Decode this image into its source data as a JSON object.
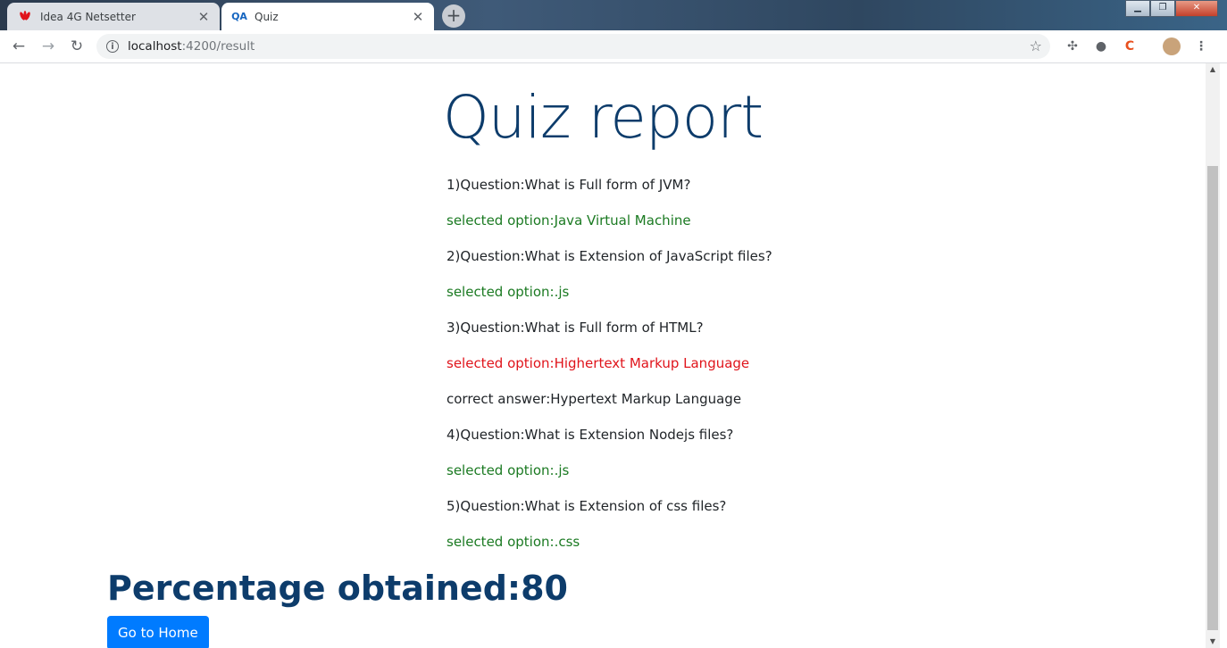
{
  "browser": {
    "tabs": [
      {
        "title": "Idea 4G Netsetter",
        "favicon": "huawei-icon",
        "active": false
      },
      {
        "title": "Quiz",
        "favicon": "QA",
        "active": true
      }
    ],
    "url_host": "localhost",
    "url_path": ":4200/result"
  },
  "page": {
    "title": "Quiz report",
    "items": [
      {
        "text": "1)Question:What is Full form of JVM?",
        "status": "question"
      },
      {
        "text": "selected option:Java Virtual Machine",
        "status": "correct"
      },
      {
        "text": "2)Question:What is Extension of JavaScript files?",
        "status": "question"
      },
      {
        "text": "selected option:.js",
        "status": "correct"
      },
      {
        "text": "3)Question:What is Full form of HTML?",
        "status": "question"
      },
      {
        "text": "selected option:Highertext Markup Language",
        "status": "wrong"
      },
      {
        "text": "correct answer:Hypertext Markup Language",
        "status": "answer"
      },
      {
        "text": "4)Question:What is Extension Nodejs files?",
        "status": "question"
      },
      {
        "text": "selected option:.js",
        "status": "correct"
      },
      {
        "text": "5)Question:What is Extension of css files?",
        "status": "question"
      },
      {
        "text": "selected option:.css",
        "status": "correct"
      }
    ],
    "percentage_label": "Percentage obtained:80",
    "home_button": "Go to Home"
  },
  "colors": {
    "title": "#0d3c6b",
    "correct": "#1b7a22",
    "wrong": "#e0141b",
    "button": "#007bff"
  }
}
